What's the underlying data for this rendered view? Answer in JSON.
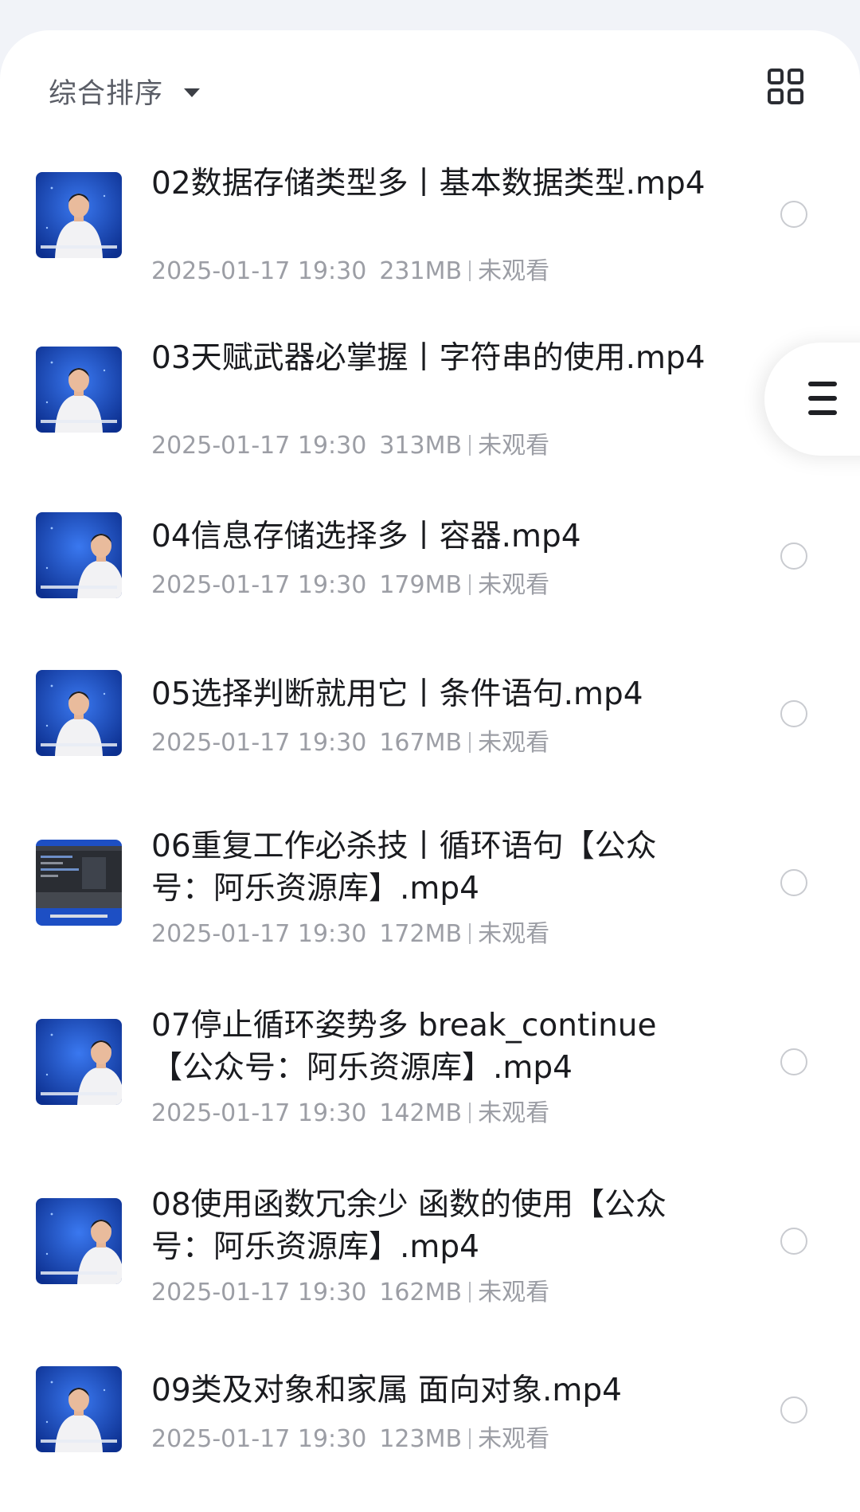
{
  "sort": {
    "label": "综合排序",
    "icon": "caret-down-icon"
  },
  "view_toggle": {
    "icon": "grid-view-icon"
  },
  "side_menu": {
    "icon": "menu-icon"
  },
  "colors": {
    "sheet_bg": "#ffffff",
    "page_bg": "#f1f3f8",
    "title_text": "#1a1b1f",
    "meta_text": "#9c9ea5",
    "thumb_blue": "#1d4fc4"
  },
  "files": [
    {
      "title": "02数据存储类型多丨基本数据类型.mp4",
      "date": "2025-01-17 19:30",
      "size": "231MB",
      "status": "未观看",
      "thumb": "presenter-center"
    },
    {
      "title": "03天赋武器必掌握丨字符串的使用.mp4",
      "date": "2025-01-17 19:30",
      "size": "313MB",
      "status": "未观看",
      "thumb": "presenter-center"
    },
    {
      "title": "04信息存储选择多丨容器.mp4",
      "date": "2025-01-17 19:30",
      "size": "179MB",
      "status": "未观看",
      "thumb": "presenter-right"
    },
    {
      "title": "05选择判断就用它丨条件语句.mp4",
      "date": "2025-01-17 19:30",
      "size": "167MB",
      "status": "未观看",
      "thumb": "presenter-center"
    },
    {
      "title": "06重复工作必杀技丨循环语句【公众号：阿乐资源库】.mp4",
      "date": "2025-01-17 19:30",
      "size": "172MB",
      "status": "未观看",
      "thumb": "code-editor"
    },
    {
      "title": "07停止循环姿势多 break_continue【公众号：阿乐资源库】.mp4",
      "date": "2025-01-17 19:30",
      "size": "142MB",
      "status": "未观看",
      "thumb": "presenter-right"
    },
    {
      "title": "08使用函数冗余少 函数的使用【公众号：阿乐资源库】.mp4",
      "date": "2025-01-17 19:30",
      "size": "162MB",
      "status": "未观看",
      "thumb": "presenter-right"
    },
    {
      "title": "09类及对象和家属 面向对象.mp4",
      "date": "2025-01-17 19:30",
      "size": "123MB",
      "status": "未观看",
      "thumb": "presenter-center"
    }
  ]
}
